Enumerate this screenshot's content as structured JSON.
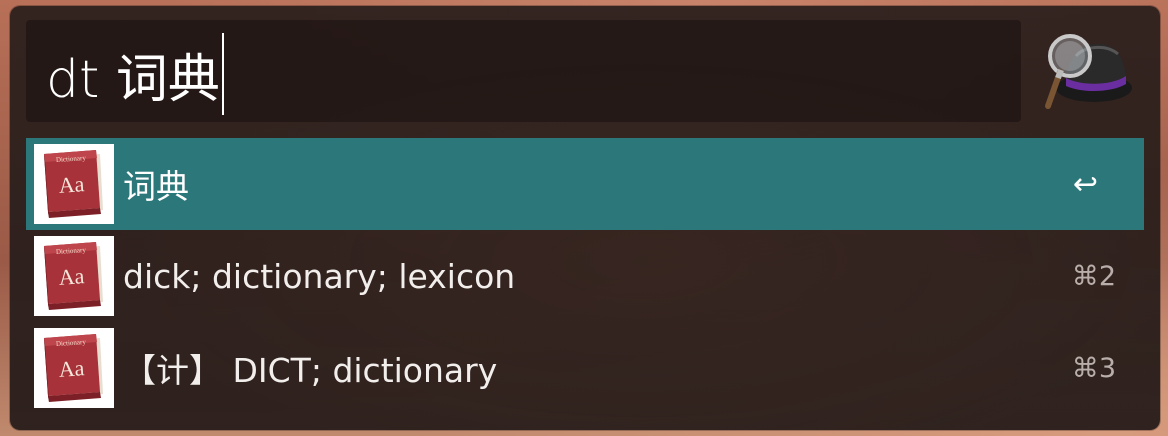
{
  "search": {
    "query": "dt 词典"
  },
  "app_icon": "alfred-hat-icon",
  "results": [
    {
      "title": "词典",
      "shortcut": "↩",
      "icon": "dictionary-book-icon",
      "icon_label": "Dictionary",
      "icon_glyph": "Aa",
      "selected": true
    },
    {
      "title": "dick; dictionary; lexicon",
      "shortcut": "⌘2",
      "icon": "dictionary-book-icon",
      "icon_label": "Dictionary",
      "icon_glyph": "Aa",
      "selected": false
    },
    {
      "title": "【计】 DICT; dictionary",
      "shortcut": "⌘3",
      "icon": "dictionary-book-icon",
      "icon_label": "Dictionary",
      "icon_glyph": "Aa",
      "selected": false
    }
  ],
  "colors": {
    "selection": "#2b777a",
    "book": "#a8323a"
  }
}
